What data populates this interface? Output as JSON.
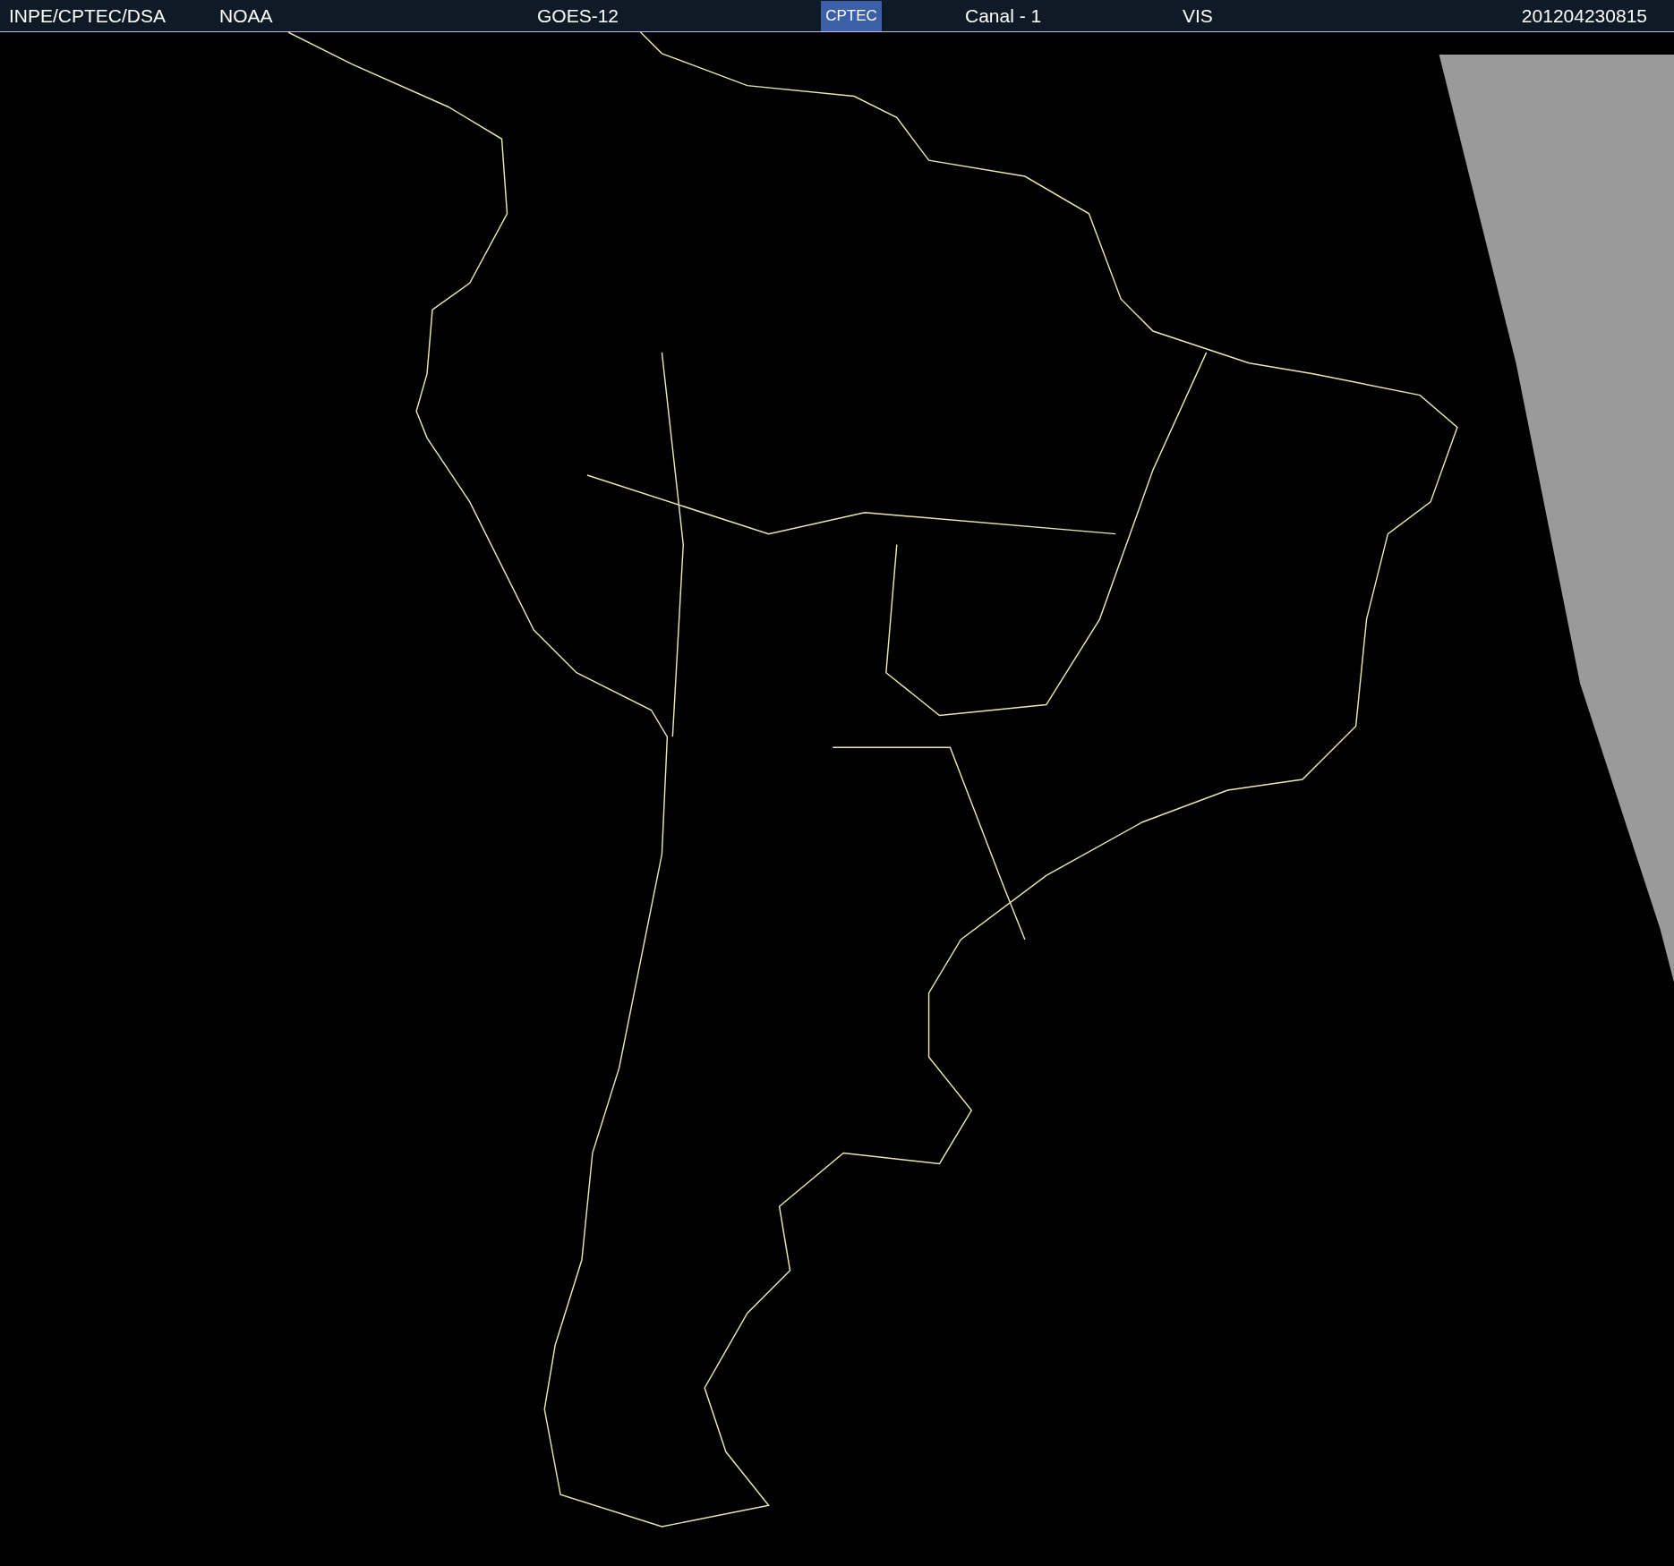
{
  "header": {
    "source": "INPE/CPTEC/DSA",
    "agency": "NOAA",
    "satellite": "GOES-12",
    "logo": "CPTEC",
    "channel": "Canal - 1",
    "band": "VIS",
    "timestamp": "201204230815"
  }
}
